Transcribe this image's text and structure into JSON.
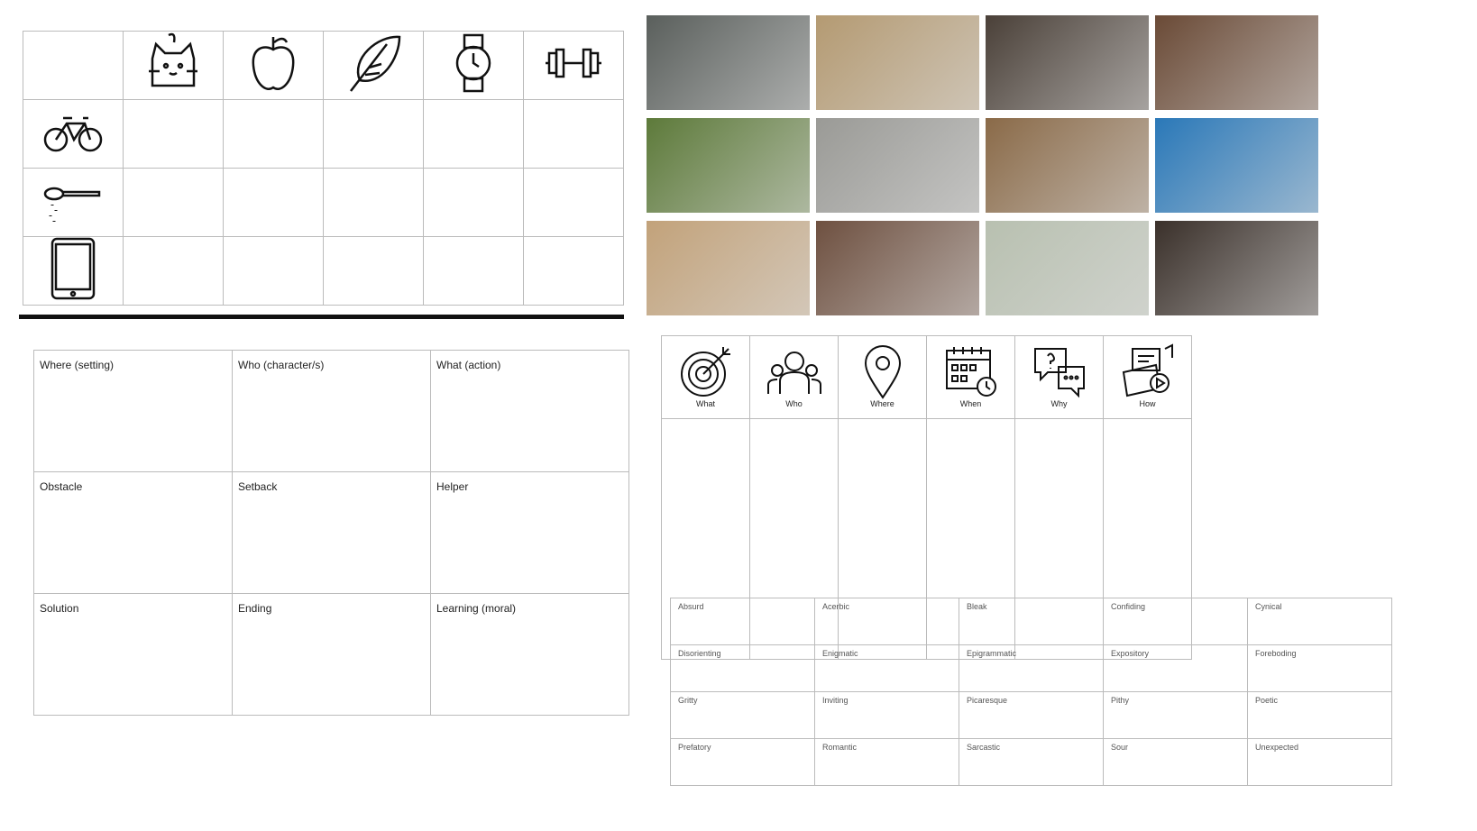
{
  "icon_grid": {
    "column_icons": [
      "cat-icon",
      "apple-icon",
      "feather-icon",
      "watch-icon",
      "dumbbell-icon"
    ],
    "row_icons": [
      "bicycle-icon",
      "spoon-icon",
      "tablet-icon"
    ]
  },
  "photos": [
    {
      "name": "chalkboard-photo",
      "color": "#5a5f5c"
    },
    {
      "name": "sleeping-dog-photo",
      "color": "#b49a72"
    },
    {
      "name": "soil-photo",
      "color": "#4a4038"
    },
    {
      "name": "paint-palette-photo",
      "color": "#6a4a36"
    },
    {
      "name": "aerial-houses-photo",
      "color": "#5d7a3a"
    },
    {
      "name": "typewriter-photo",
      "color": "#9a9a96"
    },
    {
      "name": "globe-photo",
      "color": "#8a6a48"
    },
    {
      "name": "jellyfish-photo",
      "color": "#2a78b8"
    },
    {
      "name": "scrabble-tiles-photo",
      "color": "#c2a27a"
    },
    {
      "name": "cookie-dough-photo",
      "color": "#6e5040"
    },
    {
      "name": "lab-flask-photo",
      "color": "#b8c0b0"
    },
    {
      "name": "piano-sheet-music-photo",
      "color": "#3a302a"
    }
  ],
  "story": [
    [
      "Where (setting)",
      "Who (character/s)",
      "What (action)"
    ],
    [
      "Obstacle",
      "Setback",
      "Helper"
    ],
    [
      "Solution",
      "Ending",
      "Learning (moral)"
    ]
  ],
  "five_w": [
    {
      "label": "What",
      "icon": "target-icon"
    },
    {
      "label": "Who",
      "icon": "people-icon"
    },
    {
      "label": "Where",
      "icon": "map-pin-icon"
    },
    {
      "label": "When",
      "icon": "calendar-clock-icon"
    },
    {
      "label": "Why",
      "icon": "question-chat-icon"
    },
    {
      "label": "How",
      "icon": "media-icon"
    }
  ],
  "words": [
    [
      "Absurd",
      "Acerbic",
      "Bleak",
      "Confiding",
      "Cynical"
    ],
    [
      "Disorienting",
      "Enigmatic",
      "Epigrammatic",
      "Expository",
      "Foreboding"
    ],
    [
      "Gritty",
      "Inviting",
      "Picaresque",
      "Pithy",
      "Poetic"
    ],
    [
      "Prefatory",
      "Romantic",
      "Sarcastic",
      "Sour",
      "Unexpected"
    ]
  ]
}
